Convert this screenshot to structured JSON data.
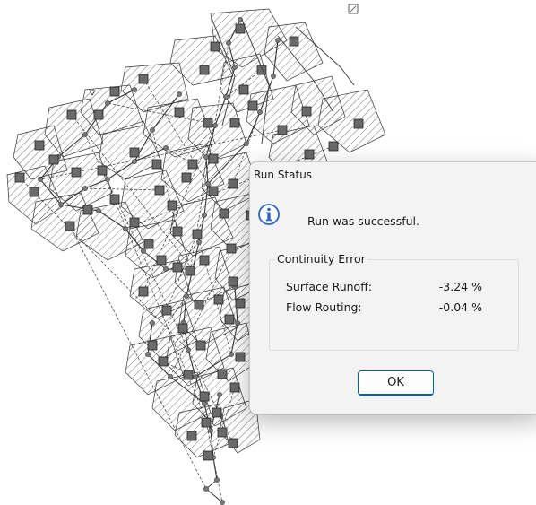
{
  "dialog": {
    "title": "Run Status",
    "icon": "info-icon",
    "message": "Run was successful.",
    "group_title": "Continuity Error",
    "errors": [
      {
        "label": "Surface Runoff:",
        "value": "-3.24 %"
      },
      {
        "label": "Flow Routing:",
        "value": "-0.04 %"
      }
    ],
    "ok_label": "OK"
  },
  "colors": {
    "accent": "#005fb8",
    "icon_blue": "#2a63c9",
    "hatch": "#555555",
    "subcatchment_box": "#6a6a6a",
    "node": "#7a7a7a"
  }
}
